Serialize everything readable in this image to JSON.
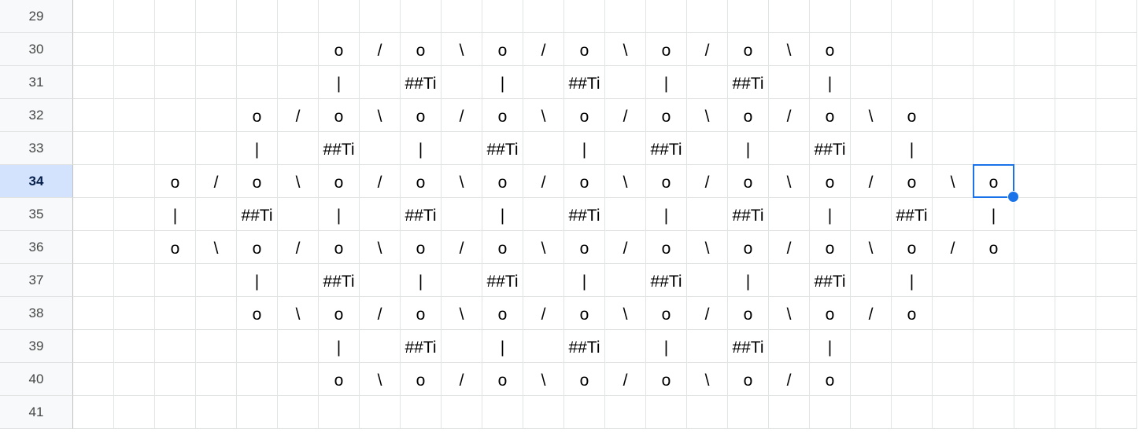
{
  "sheet": {
    "selected_row": "34",
    "selected_cell_value": "o",
    "rows": [
      {
        "row_number": "29",
        "cells": []
      },
      {
        "row_number": "30",
        "cells": [
          {
            "col": 8,
            "text": "o"
          },
          {
            "col": 9,
            "text": "/"
          },
          {
            "col": 10,
            "text": "o"
          },
          {
            "col": 11,
            "text": "\\"
          },
          {
            "col": 12,
            "text": "o"
          },
          {
            "col": 13,
            "text": "/"
          },
          {
            "col": 14,
            "text": "o"
          },
          {
            "col": 15,
            "text": "\\"
          },
          {
            "col": 16,
            "text": "o"
          },
          {
            "col": 17,
            "text": "/"
          },
          {
            "col": 18,
            "text": "o"
          },
          {
            "col": 19,
            "text": "\\"
          },
          {
            "col": 20,
            "text": "o"
          }
        ]
      },
      {
        "row_number": "31",
        "cells": [
          {
            "col": 8,
            "text": "|"
          },
          {
            "col": 10,
            "text": "##Ti"
          },
          {
            "col": 12,
            "text": "|"
          },
          {
            "col": 14,
            "text": "##Ti"
          },
          {
            "col": 16,
            "text": "|"
          },
          {
            "col": 18,
            "text": "##Ti"
          },
          {
            "col": 20,
            "text": "|"
          }
        ]
      },
      {
        "row_number": "32",
        "cells": [
          {
            "col": 6,
            "text": "o"
          },
          {
            "col": 7,
            "text": "/"
          },
          {
            "col": 8,
            "text": "o"
          },
          {
            "col": 9,
            "text": "\\"
          },
          {
            "col": 10,
            "text": "o"
          },
          {
            "col": 11,
            "text": "/"
          },
          {
            "col": 12,
            "text": "o"
          },
          {
            "col": 13,
            "text": "\\"
          },
          {
            "col": 14,
            "text": "o"
          },
          {
            "col": 15,
            "text": "/"
          },
          {
            "col": 16,
            "text": "o"
          },
          {
            "col": 17,
            "text": "\\"
          },
          {
            "col": 18,
            "text": "o"
          },
          {
            "col": 19,
            "text": "/"
          },
          {
            "col": 20,
            "text": "o"
          },
          {
            "col": 21,
            "text": "\\"
          },
          {
            "col": 22,
            "text": "o"
          }
        ]
      },
      {
        "row_number": "33",
        "cells": [
          {
            "col": 6,
            "text": "|"
          },
          {
            "col": 8,
            "text": "##Ti"
          },
          {
            "col": 10,
            "text": "|"
          },
          {
            "col": 12,
            "text": "##Ti"
          },
          {
            "col": 14,
            "text": "|"
          },
          {
            "col": 16,
            "text": "##Ti"
          },
          {
            "col": 18,
            "text": "|"
          },
          {
            "col": 20,
            "text": "##Ti"
          },
          {
            "col": 22,
            "text": "|"
          }
        ]
      },
      {
        "row_number": "34",
        "cells": [
          {
            "col": 4,
            "text": "o"
          },
          {
            "col": 5,
            "text": "/"
          },
          {
            "col": 6,
            "text": "o"
          },
          {
            "col": 7,
            "text": "\\"
          },
          {
            "col": 8,
            "text": "o"
          },
          {
            "col": 9,
            "text": "/"
          },
          {
            "col": 10,
            "text": "o"
          },
          {
            "col": 11,
            "text": "\\"
          },
          {
            "col": 12,
            "text": "o"
          },
          {
            "col": 13,
            "text": "/"
          },
          {
            "col": 14,
            "text": "o"
          },
          {
            "col": 15,
            "text": "\\"
          },
          {
            "col": 16,
            "text": "o"
          },
          {
            "col": 17,
            "text": "/"
          },
          {
            "col": 18,
            "text": "o"
          },
          {
            "col": 19,
            "text": "\\"
          },
          {
            "col": 20,
            "text": "o"
          },
          {
            "col": 21,
            "text": "/"
          },
          {
            "col": 22,
            "text": "o"
          },
          {
            "col": 23,
            "text": "\\"
          },
          {
            "col": 24,
            "text": "o"
          }
        ]
      },
      {
        "row_number": "35",
        "cells": [
          {
            "col": 4,
            "text": "|"
          },
          {
            "col": 6,
            "text": "##Ti"
          },
          {
            "col": 8,
            "text": "|"
          },
          {
            "col": 10,
            "text": "##Ti"
          },
          {
            "col": 12,
            "text": "|"
          },
          {
            "col": 14,
            "text": "##Ti"
          },
          {
            "col": 16,
            "text": "|"
          },
          {
            "col": 18,
            "text": "##Ti"
          },
          {
            "col": 20,
            "text": "|"
          },
          {
            "col": 22,
            "text": "##Ti"
          },
          {
            "col": 24,
            "text": "|"
          }
        ]
      },
      {
        "row_number": "36",
        "cells": [
          {
            "col": 4,
            "text": "o"
          },
          {
            "col": 5,
            "text": "\\"
          },
          {
            "col": 6,
            "text": "o"
          },
          {
            "col": 7,
            "text": "/"
          },
          {
            "col": 8,
            "text": "o"
          },
          {
            "col": 9,
            "text": "\\"
          },
          {
            "col": 10,
            "text": "o"
          },
          {
            "col": 11,
            "text": "/"
          },
          {
            "col": 12,
            "text": "o"
          },
          {
            "col": 13,
            "text": "\\"
          },
          {
            "col": 14,
            "text": "o"
          },
          {
            "col": 15,
            "text": "/"
          },
          {
            "col": 16,
            "text": "o"
          },
          {
            "col": 17,
            "text": "\\"
          },
          {
            "col": 18,
            "text": "o"
          },
          {
            "col": 19,
            "text": "/"
          },
          {
            "col": 20,
            "text": "o"
          },
          {
            "col": 21,
            "text": "\\"
          },
          {
            "col": 22,
            "text": "o"
          },
          {
            "col": 23,
            "text": "/"
          },
          {
            "col": 24,
            "text": "o"
          }
        ]
      },
      {
        "row_number": "37",
        "cells": [
          {
            "col": 6,
            "text": "|"
          },
          {
            "col": 8,
            "text": "##Ti"
          },
          {
            "col": 10,
            "text": "|"
          },
          {
            "col": 12,
            "text": "##Ti"
          },
          {
            "col": 14,
            "text": "|"
          },
          {
            "col": 16,
            "text": "##Ti"
          },
          {
            "col": 18,
            "text": "|"
          },
          {
            "col": 20,
            "text": "##Ti"
          },
          {
            "col": 22,
            "text": "|"
          }
        ]
      },
      {
        "row_number": "38",
        "cells": [
          {
            "col": 6,
            "text": "o"
          },
          {
            "col": 7,
            "text": "\\"
          },
          {
            "col": 8,
            "text": "o"
          },
          {
            "col": 9,
            "text": "/"
          },
          {
            "col": 10,
            "text": "o"
          },
          {
            "col": 11,
            "text": "\\"
          },
          {
            "col": 12,
            "text": "o"
          },
          {
            "col": 13,
            "text": "/"
          },
          {
            "col": 14,
            "text": "o"
          },
          {
            "col": 15,
            "text": "\\"
          },
          {
            "col": 16,
            "text": "o"
          },
          {
            "col": 17,
            "text": "/"
          },
          {
            "col": 18,
            "text": "o"
          },
          {
            "col": 19,
            "text": "\\"
          },
          {
            "col": 20,
            "text": "o"
          },
          {
            "col": 21,
            "text": "/"
          },
          {
            "col": 22,
            "text": "o"
          }
        ]
      },
      {
        "row_number": "39",
        "cells": [
          {
            "col": 8,
            "text": "|"
          },
          {
            "col": 10,
            "text": "##Ti"
          },
          {
            "col": 12,
            "text": "|"
          },
          {
            "col": 14,
            "text": "##Ti"
          },
          {
            "col": 16,
            "text": "|"
          },
          {
            "col": 18,
            "text": "##Ti"
          },
          {
            "col": 20,
            "text": "|"
          }
        ]
      },
      {
        "row_number": "40",
        "cells": [
          {
            "col": 8,
            "text": "o"
          },
          {
            "col": 9,
            "text": "\\"
          },
          {
            "col": 10,
            "text": "o"
          },
          {
            "col": 11,
            "text": "/"
          },
          {
            "col": 12,
            "text": "o"
          },
          {
            "col": 13,
            "text": "\\"
          },
          {
            "col": 14,
            "text": "o"
          },
          {
            "col": 15,
            "text": "/"
          },
          {
            "col": 16,
            "text": "o"
          },
          {
            "col": 17,
            "text": "\\"
          },
          {
            "col": 18,
            "text": "o"
          },
          {
            "col": 19,
            "text": "/"
          },
          {
            "col": 20,
            "text": "o"
          }
        ]
      },
      {
        "row_number": "41",
        "cells": []
      }
    ]
  }
}
